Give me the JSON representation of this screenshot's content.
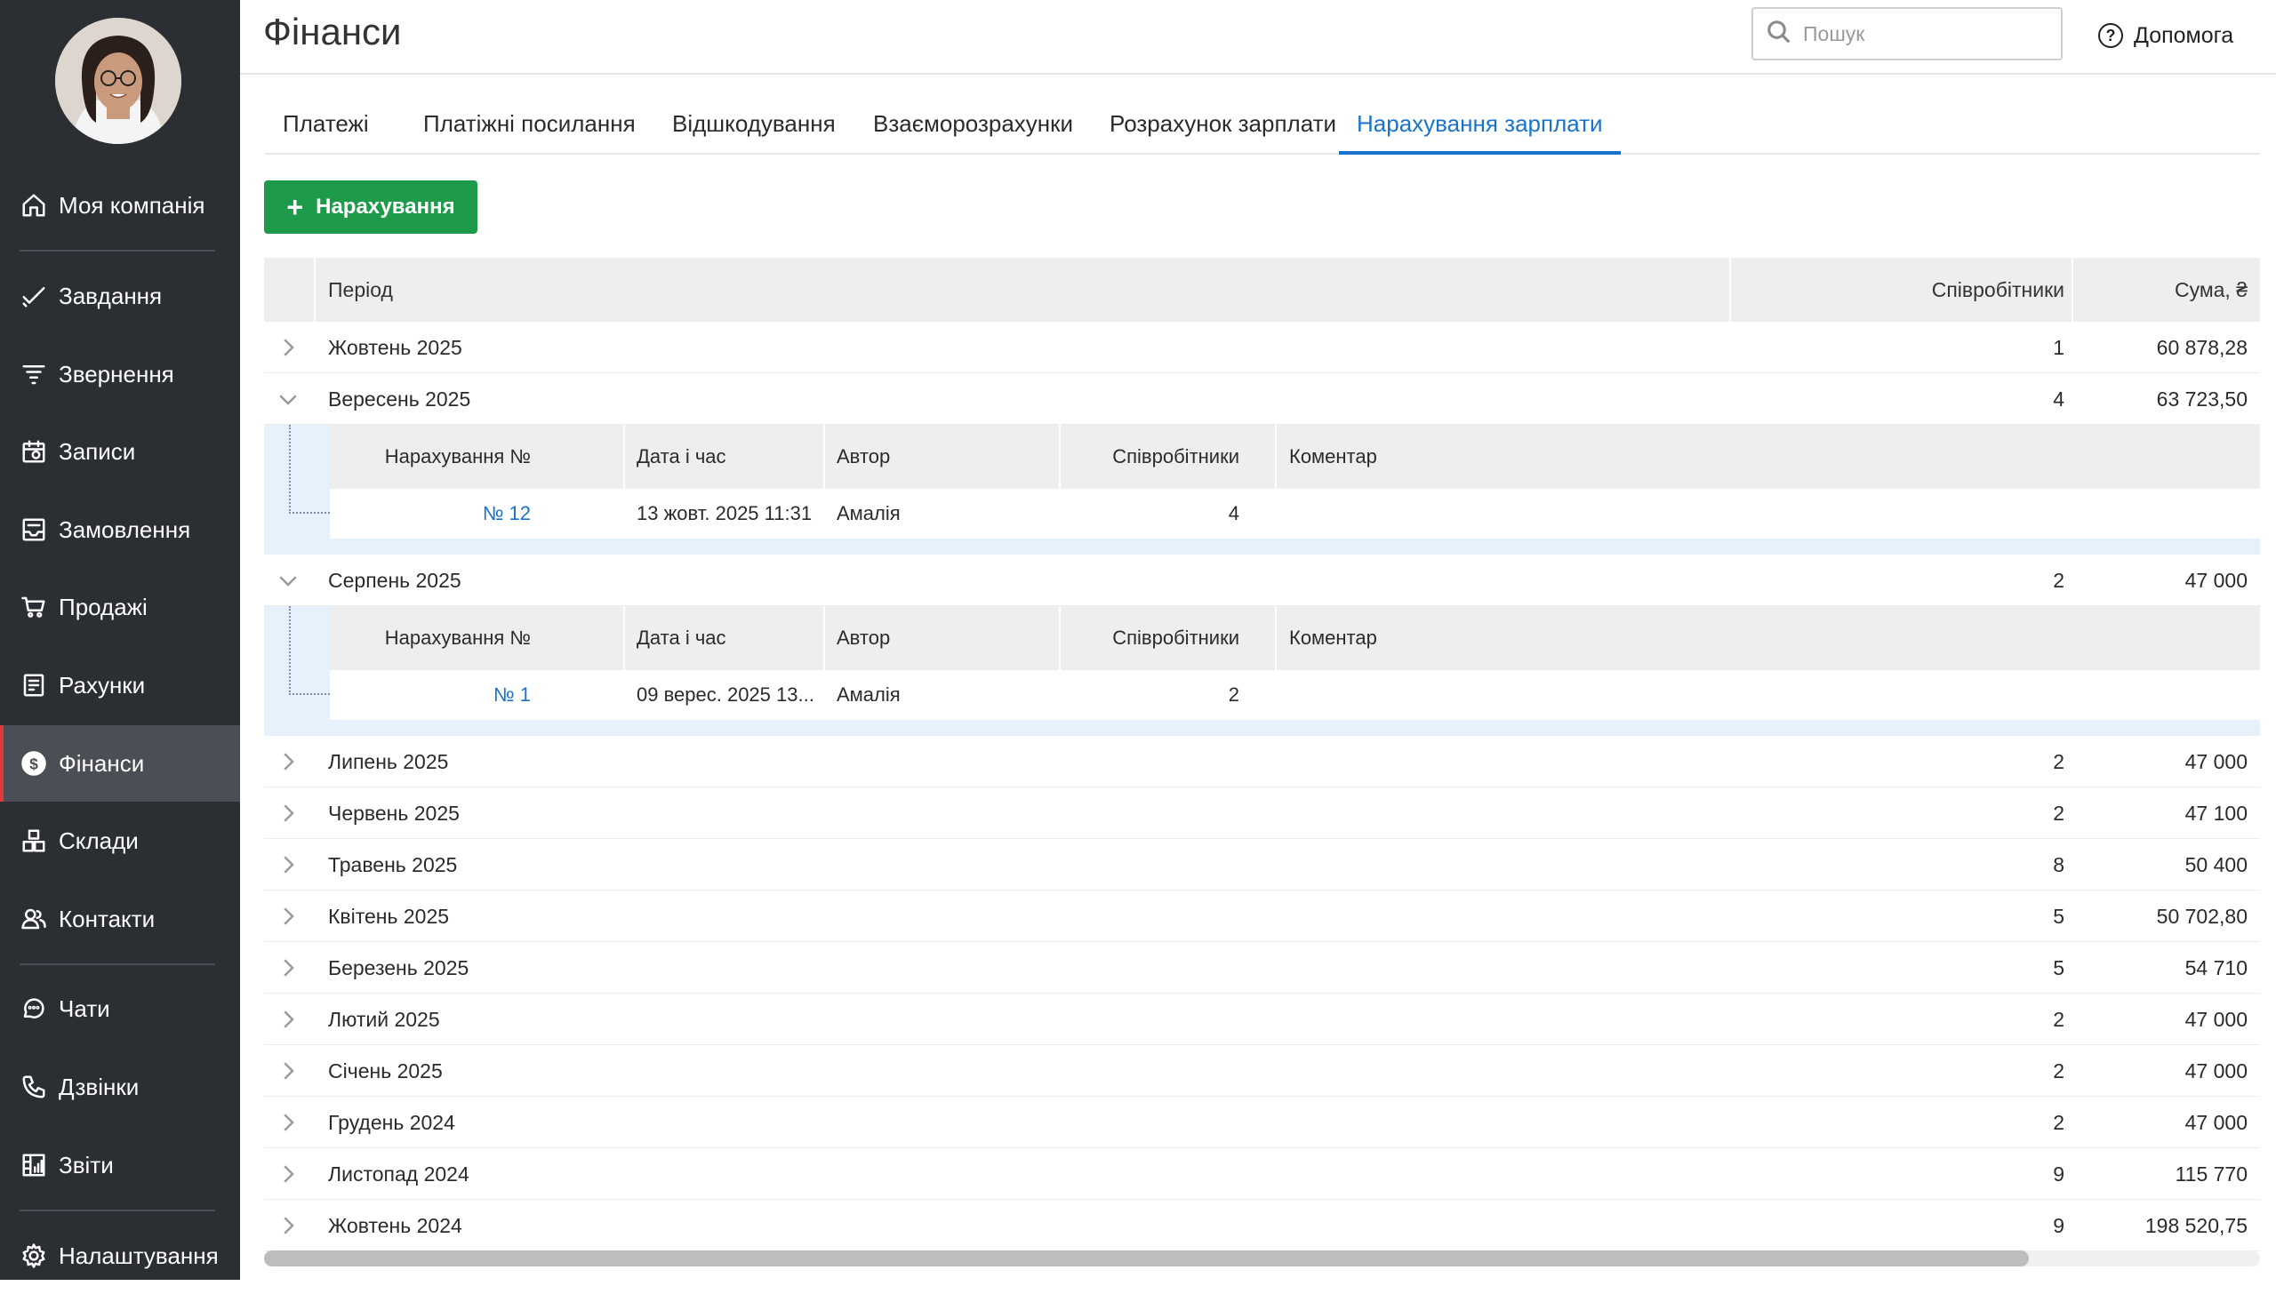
{
  "sidebar": {
    "items": [
      {
        "label": "Моя компанія",
        "icon": "home-icon"
      },
      {
        "label": "Завдання",
        "icon": "check-icon"
      },
      {
        "label": "Звернення",
        "icon": "funnel-icon"
      },
      {
        "label": "Записи",
        "icon": "calendar-icon"
      },
      {
        "label": "Замовлення",
        "icon": "orders-icon"
      },
      {
        "label": "Продажі",
        "icon": "cart-icon"
      },
      {
        "label": "Рахунки",
        "icon": "invoice-icon"
      },
      {
        "label": "Фінанси",
        "icon": "dollar-icon",
        "active": true
      },
      {
        "label": "Склади",
        "icon": "boxes-icon"
      },
      {
        "label": "Контакти",
        "icon": "contacts-icon"
      },
      {
        "label": "Чати",
        "icon": "chat-icon"
      },
      {
        "label": "Дзвінки",
        "icon": "phone-icon"
      },
      {
        "label": "Звіти",
        "icon": "reports-icon"
      },
      {
        "label": "Налаштування",
        "icon": "gear-icon"
      }
    ],
    "accent_color": "#e03a3a"
  },
  "header": {
    "title": "Фінанси",
    "search_placeholder": "Пошук",
    "help_label": "Допомога"
  },
  "tabs": [
    {
      "label": "Платежі"
    },
    {
      "label": "Платіжні посилання"
    },
    {
      "label": "Відшкодування"
    },
    {
      "label": "Взаєморозрахунки"
    },
    {
      "label": "Розрахунок зарплати"
    },
    {
      "label": "Нарахування зарплати",
      "active": true
    }
  ],
  "add_button": {
    "label": "Нарахування"
  },
  "table": {
    "headers": {
      "period": "Період",
      "employees": "Співробітники",
      "sum": "Сума, ₴"
    },
    "sub_headers": {
      "number": "Нарахування №",
      "datetime": "Дата і час",
      "author": "Автор",
      "employees": "Співробітники",
      "comment": "Коментар"
    },
    "rows": [
      {
        "period": "Жовтень 2025",
        "employees": "1",
        "sum": "60 878,28"
      },
      {
        "period": "Вересень 2025",
        "employees": "4",
        "sum": "63 723,50"
      },
      {
        "period": "Серпень 2025",
        "employees": "2",
        "sum": "47 000"
      },
      {
        "period": "Липень 2025",
        "employees": "2",
        "sum": "47 000"
      },
      {
        "period": "Червень 2025",
        "employees": "2",
        "sum": "47 100"
      },
      {
        "period": "Травень 2025",
        "employees": "8",
        "sum": "50 400"
      },
      {
        "period": "Квітень 2025",
        "employees": "5",
        "sum": "50 702,80"
      },
      {
        "period": "Березень 2025",
        "employees": "5",
        "sum": "54 710"
      },
      {
        "period": "Лютий 2025",
        "employees": "2",
        "sum": "47 000"
      },
      {
        "period": "Січень 2025",
        "employees": "2",
        "sum": "47 000"
      },
      {
        "period": "Грудень 2024",
        "employees": "2",
        "sum": "47 000"
      },
      {
        "period": "Листопад 2024",
        "employees": "9",
        "sum": "115 770"
      },
      {
        "period": "Жовтень 2024",
        "employees": "9",
        "sum": "198 520,75"
      }
    ],
    "sub_rows": {
      "Вересень 2025": {
        "number": "№ 12",
        "datetime": "13 жовт. 2025 11:31",
        "author": "Амалія",
        "employees": "4",
        "comment": ""
      },
      "Серпень 2025": {
        "number": "№ 1",
        "datetime": "09 верес. 2025 13...",
        "author": "Амалія",
        "employees": "2",
        "comment": ""
      }
    }
  }
}
